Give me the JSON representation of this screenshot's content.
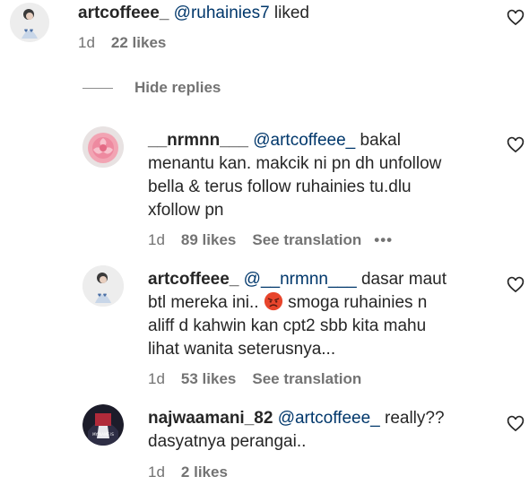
{
  "comments": [
    {
      "username": "artcoffeee_",
      "mention": "@ruhainies7",
      "text_parts": [
        "liked"
      ],
      "time": "1d",
      "likes": "22 likes"
    },
    {
      "username": "__nrmnn___",
      "mention": "@artcoffeee_",
      "text_parts": [
        "bakal",
        "menantu kan. makcik ni pn dh unfollow",
        "bella & terus follow ruhainies tu.dlu",
        "xfollow pn"
      ],
      "time": "1d",
      "likes": "89 likes",
      "translation": "See translation",
      "more": "•••"
    },
    {
      "username": "artcoffeee_",
      "mention": "@__nrmnn___",
      "text_parts": [
        "dasar maut",
        "btl mereka ini..",
        "smoga ruhainies n",
        "aliff d kahwin kan cpt2 sbb kita mahu",
        "lihat wanita seterusnya..."
      ],
      "time": "1d",
      "likes": "53 likes",
      "translation": "See translation"
    },
    {
      "username": "najwaamani_82",
      "mention": "@artcoffeee_",
      "text_parts": [
        "really??",
        "dasyatnya perangai.."
      ],
      "time": "1d",
      "likes": "2 likes"
    }
  ],
  "replies_toggle": "Hide replies",
  "avatar_badge_text": "MY NAME IS"
}
